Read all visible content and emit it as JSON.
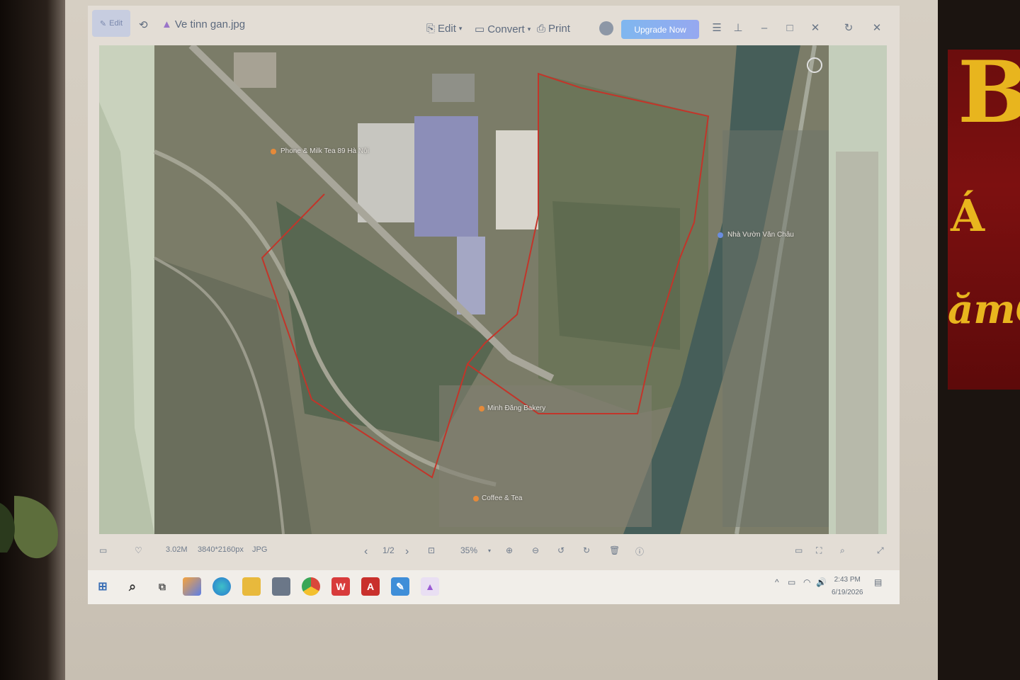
{
  "window": {
    "filename": "Ve tinn gan.jpg",
    "edit_chip_label": "Edit",
    "menu": {
      "edit_label": "Edit",
      "convert_label": "Convert",
      "print_label": "Print",
      "upgrade_label": "Upgrade Now"
    },
    "icons": [
      "edit-icon",
      "lasso-icon",
      "app-logo-icon",
      "avatar-icon",
      "hamburger-menu-icon",
      "pin-icon",
      "minimize-icon",
      "maximize-icon",
      "close-icon",
      "rotate-icon",
      "window-close-icon"
    ]
  },
  "map": {
    "labels": [
      {
        "text": "Phone & Milk Tea 89 Hà Nội",
        "id": "poi-milk-tea"
      },
      {
        "text": "Nhà Vườn Văn Châu",
        "id": "poi-nha-vuon"
      },
      {
        "text": "Minh Đăng Bakery",
        "id": "poi-bakery"
      },
      {
        "text": "Coffee & Tea",
        "id": "poi-coffee"
      }
    ]
  },
  "bottombar": {
    "file_size": "3.02M",
    "dimensions": "3840*2160px",
    "format": "JPG",
    "page_indicator": "1/2",
    "zoom_level": "35%"
  },
  "taskbar": {
    "apps": [
      "start-icon",
      "search-icon",
      "task-view-icon",
      "copilot-icon",
      "edge-icon",
      "file-explorer-icon",
      "store-icon",
      "chrome-icon",
      "wps-icon",
      "acrobat-icon",
      "paint-icon",
      "image-viewer-icon"
    ],
    "time": "2:43 PM",
    "date": "6/19/2026"
  },
  "room": {
    "banner_letters": [
      "B",
      "Á",
      "ămG"
    ],
    "colors": {
      "banner": "#7d1010",
      "banner_text": "#e8b51e",
      "upgrade": "#7fb7ef"
    }
  }
}
